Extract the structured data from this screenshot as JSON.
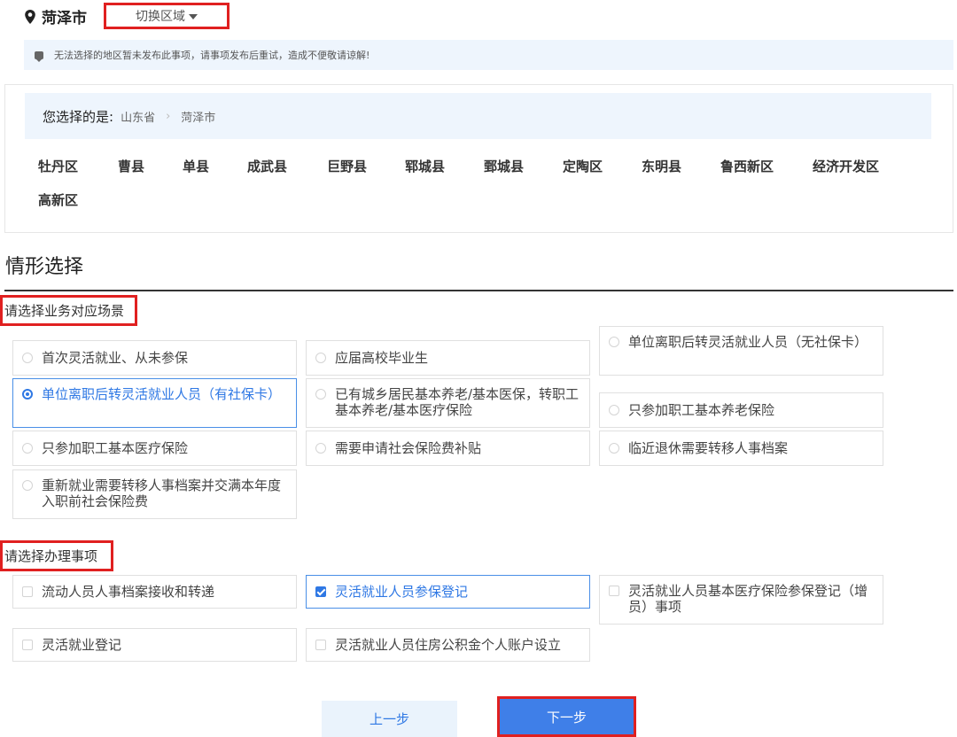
{
  "header": {
    "city": "菏泽市",
    "switch_label": "切换区域"
  },
  "notice": {
    "text": "无法选择的地区暂未发布此事项，请事项发布后重试，造成不便敬请谅解!"
  },
  "region": {
    "selected_label": "您选择的是:",
    "breadcrumb": [
      "山东省",
      "菏泽市"
    ],
    "districts": [
      "牡丹区",
      "曹县",
      "单县",
      "成武县",
      "巨野县",
      "郓城县",
      "鄄城县",
      "定陶区",
      "东明县",
      "鲁西新区",
      "经济开发区",
      "高新区"
    ]
  },
  "section": {
    "title": "情形选择"
  },
  "scenario": {
    "title": "请选择业务对应场景",
    "options": [
      {
        "label": "首次灵活就业、从未参保",
        "selected": false
      },
      {
        "label": "应届高校毕业生",
        "selected": false
      },
      {
        "label": "单位离职后转灵活就业人员（无社保卡）",
        "selected": false
      },
      {
        "label": "单位离职后转灵活就业人员（有社保卡）",
        "selected": true
      },
      {
        "label": "已有城乡居民基本养老/基本医保，转职工基本养老/基本医疗保险",
        "selected": false
      },
      {
        "label": "只参加职工基本养老保险",
        "selected": false
      },
      {
        "label": "只参加职工基本医疗保险",
        "selected": false
      },
      {
        "label": "需要申请社会保险费补贴",
        "selected": false
      },
      {
        "label": "临近退休需要转移人事档案",
        "selected": false
      },
      {
        "label": "重新就业需要转移人事档案并交满本年度入职前社会保险费",
        "selected": false
      }
    ]
  },
  "matters": {
    "title": "请选择办理事项",
    "options": [
      {
        "label": "流动人员人事档案接收和转递",
        "checked": false
      },
      {
        "label": "灵活就业人员参保登记",
        "checked": true
      },
      {
        "label": "灵活就业人员基本医疗保险参保登记（增员）事项",
        "checked": false
      },
      {
        "label": "灵活就业登记",
        "checked": false
      },
      {
        "label": "灵活就业人员住房公积金个人账户设立",
        "checked": false
      }
    ]
  },
  "buttons": {
    "prev": "上一步",
    "next": "下一步"
  },
  "colors": {
    "accent": "#2f78e4",
    "highlight_border": "#e02020",
    "panel_bg": "#eef5fd"
  }
}
